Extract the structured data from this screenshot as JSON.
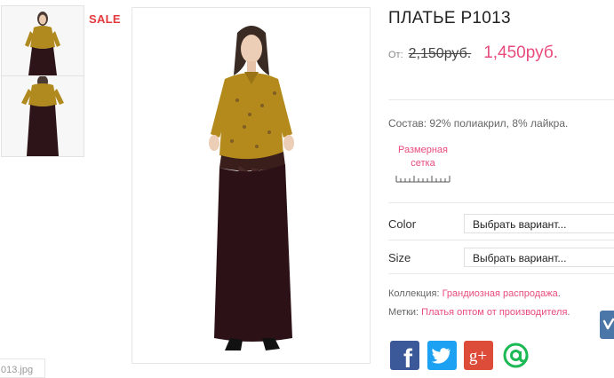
{
  "product": {
    "sale_badge": "SALE",
    "title": "ПЛАТЬЕ Р1013",
    "price_prefix": "От:",
    "old_price": "2,150руб.",
    "new_price": "1,450руб.",
    "composition": "Состав: 92% полиакрил, 8% лайкра.",
    "size_chart_line1": "Размерная",
    "size_chart_line2": "сетка"
  },
  "options": [
    {
      "label": "Color",
      "value": "Выбрать вариант..."
    },
    {
      "label": "Size",
      "value": "Выбрать вариант..."
    }
  ],
  "meta": {
    "collection_label": "Коллекция:",
    "collection_value": "Грандиозная распродажа",
    "collection_end": ".",
    "tags_label": "Метки:",
    "tags_value": "Платья оптом от производителя",
    "tags_end": "."
  },
  "gallery": {
    "filename_fragment": "013.jpg"
  },
  "social": {
    "facebook": "f",
    "twitter": "twitter-icon",
    "googleplus": "g+",
    "mail": "@"
  },
  "colors": {
    "sale": "#e4393c",
    "accent": "#e84c7d",
    "facebook": "#3b5998",
    "twitter": "#1da1f2",
    "googleplus": "#dd4b39",
    "mail": "#1db954",
    "vk": "#4a76a8"
  }
}
